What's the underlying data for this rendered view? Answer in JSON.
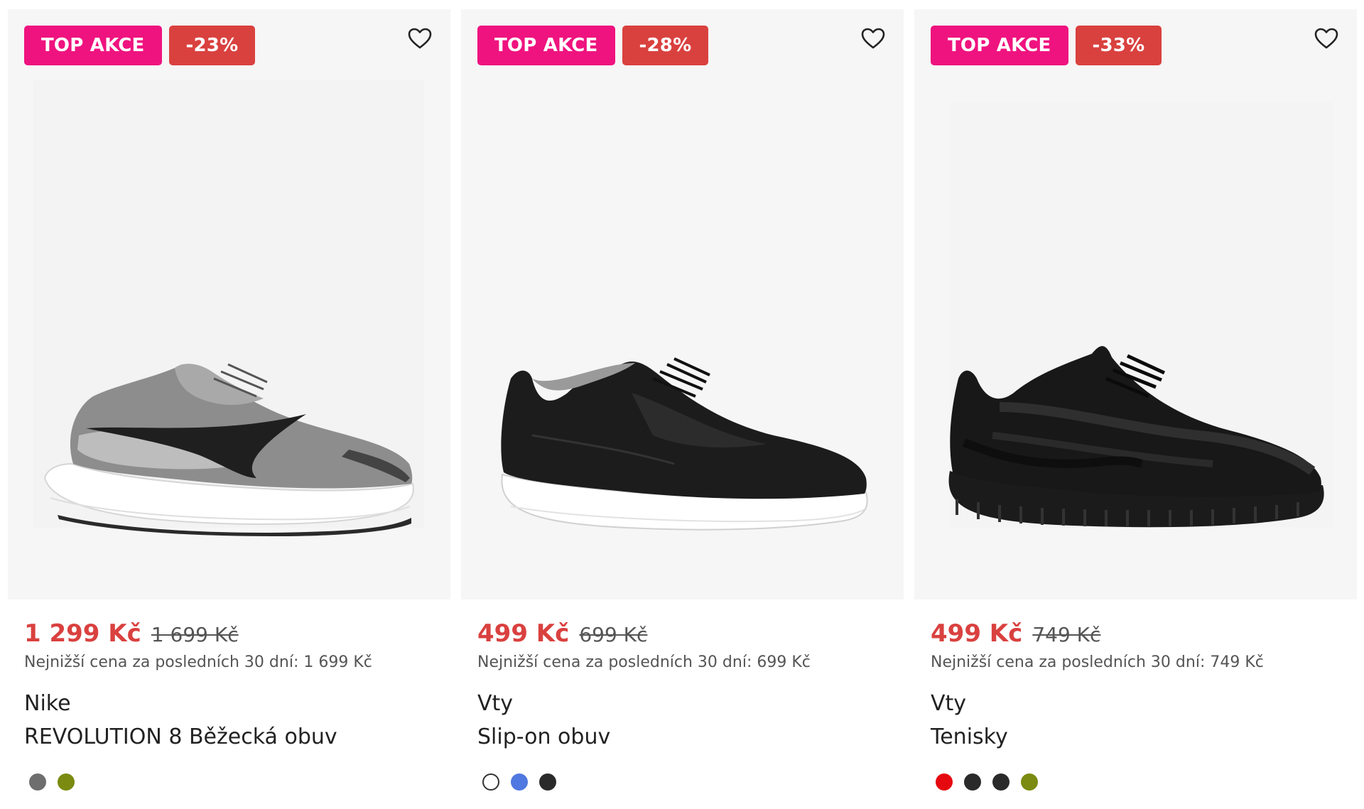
{
  "products": [
    {
      "badge_top": "TOP AKCE",
      "badge_discount": "-23%",
      "price_now": "1 299 Kč",
      "price_old": "1 699 Kč",
      "lowest_price": "Nejnižší cena za posledních 30 dní: 1 699 Kč",
      "brand": "Nike",
      "name": "REVOLUTION 8 Běžecká obuv",
      "image_icon": "grey-running-shoe",
      "swatches": [
        "#6e6e6e",
        "#7b8a10"
      ]
    },
    {
      "badge_top": "TOP AKCE",
      "badge_discount": "-28%",
      "price_now": "499 Kč",
      "price_old": "699 Kč",
      "lowest_price": "Nejnižší cena za posledních 30 dní: 699 Kč",
      "brand": "Vty",
      "name": "Slip-on obuv",
      "image_icon": "black-sneaker-white-sole",
      "swatches": [
        "#ffffff",
        "#4f78e0",
        "#2a2a2a"
      ]
    },
    {
      "badge_top": "TOP AKCE",
      "badge_discount": "-33%",
      "price_now": "499 Kč",
      "price_old": "749 Kč",
      "lowest_price": "Nejnižší cena za posledních 30 dní: 749 Kč",
      "brand": "Vty",
      "name": "Tenisky",
      "image_icon": "black-knit-sneaker",
      "swatches": [
        "#e5090f",
        "#2a2a2a",
        "#2a2a2a",
        "#7b8a10"
      ]
    }
  ],
  "icons": {
    "favorite": "heart-outline-icon"
  },
  "colors": {
    "badge_top": "#ef137f",
    "badge_discount": "#d9413f",
    "price_now": "#d9413f"
  }
}
